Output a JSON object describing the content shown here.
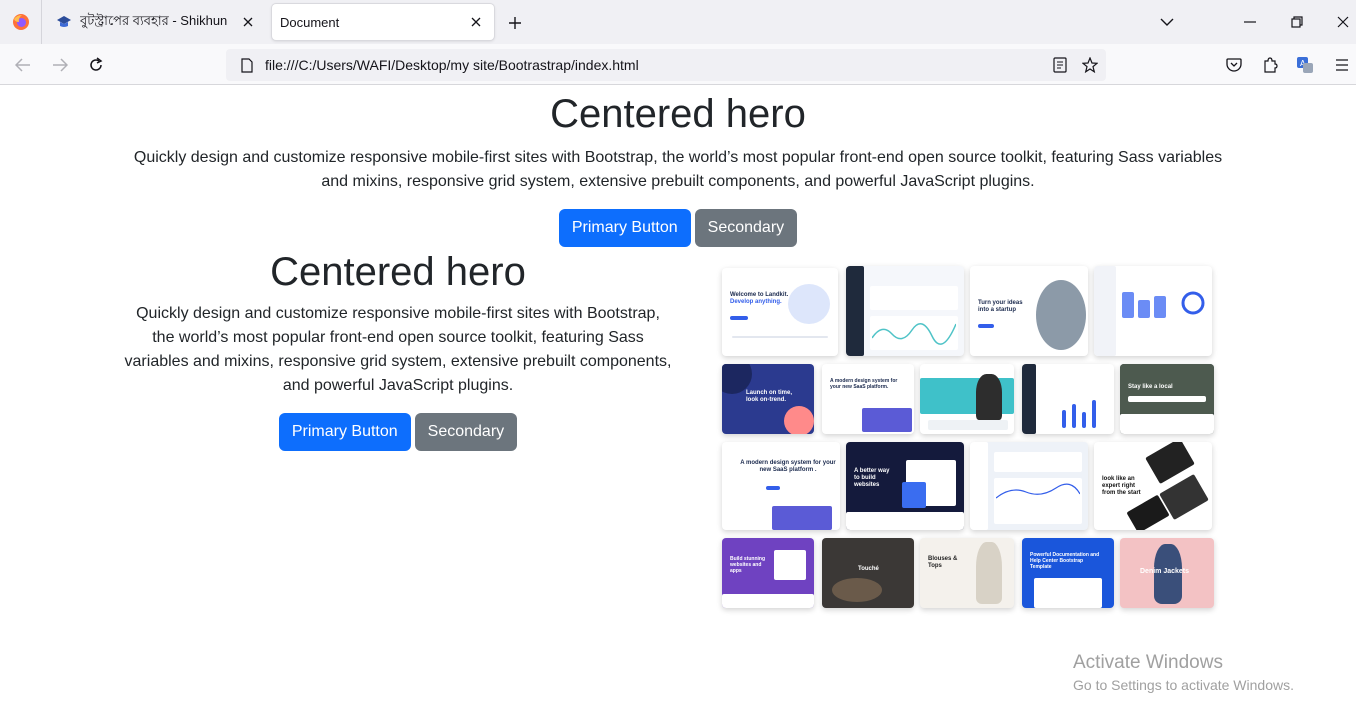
{
  "browser": {
    "tabs": [
      {
        "title": "বুটস্ট্রাপের ব্যবহার - Shikhun",
        "active": false
      },
      {
        "title": "Document",
        "active": true
      }
    ],
    "url": "file:///C:/Users/WAFI/Desktop/my site/Bootrastrap/index.html"
  },
  "hero_top": {
    "title": "Centered hero",
    "text": "Quickly design and customize responsive mobile-first sites with Bootstrap, the world’s most popular front-end open source toolkit, featuring Sass variables and mixins, responsive grid system, extensive prebuilt components, and powerful JavaScript plugins.",
    "primary_label": "Primary Button",
    "secondary_label": "Secondary"
  },
  "hero_split": {
    "title": "Centered hero",
    "text": "Quickly design and customize responsive mobile-first sites with Bootstrap, the world’s most popular front-end open source toolkit, featuring Sass variables and mixins, responsive grid system, extensive prebuilt components, and powerful JavaScript plugins.",
    "primary_label": "Primary Button",
    "secondary_label": "Secondary"
  },
  "collage_text": {
    "t1": "Welcome to Landkit.",
    "t1b": "Develop anything.",
    "t3": "Turn your ideas into a startup",
    "t5": "Launch on time, look on-trend.",
    "t6": "A modern design system for your new SaaS platform.",
    "t9": "Stay like a local",
    "t10": "A modern design system for your new SaaS platform .",
    "t11": "A better way to build websites",
    "t13": "look like an expert right from the start",
    "t14": "Build stunning websites and apps",
    "t15": "Touché",
    "t16": "Blouses & Tops",
    "t17": "Powerful Documentation and Help Center Bootstrap Template",
    "t18": "Denim Jackets"
  },
  "watermark": {
    "line1": "Activate Windows",
    "line2": "Go to Settings to activate Windows."
  },
  "colors": {
    "primary": "#0d6efd",
    "secondary": "#6c757d"
  }
}
